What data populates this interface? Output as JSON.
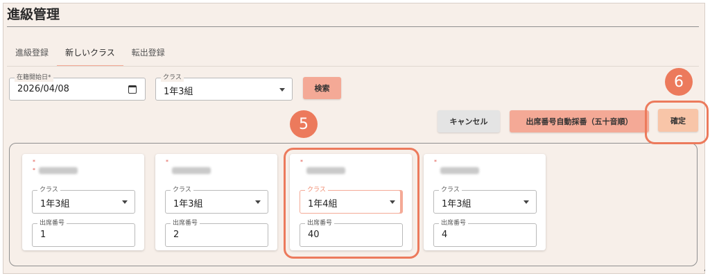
{
  "page": {
    "title": "進級管理"
  },
  "tabs": [
    {
      "label": "進級登録",
      "active": false
    },
    {
      "label": "新しいクラス",
      "active": true
    },
    {
      "label": "転出登録",
      "active": false
    }
  ],
  "filters": {
    "start_date": {
      "label": "在籍開始日*",
      "value": "2026/04/08",
      "icon": "calendar-icon"
    },
    "class": {
      "label": "クラス",
      "value": "1年3組",
      "icon": "chevron-down-icon"
    },
    "search_label": "検索"
  },
  "actions": {
    "cancel_label": "キャンセル",
    "auto_number_label": "出席番号自動採番（五十音順）",
    "confirm_label": "確定"
  },
  "students": [
    {
      "required_mark": "*",
      "class_label": "クラス",
      "class_value": "1年3組",
      "number_label": "出席番号",
      "number_value": "1"
    },
    {
      "required_mark": "*",
      "class_label": "クラス",
      "class_value": "1年3組",
      "number_label": "出席番号",
      "number_value": "2"
    },
    {
      "required_mark": "*",
      "class_label": "クラス",
      "class_value": "1年4組",
      "number_label": "出席番号",
      "number_value": "40"
    },
    {
      "required_mark": "*",
      "class_label": "クラス",
      "class_value": "1年3組",
      "number_label": "出席番号",
      "number_value": "4"
    }
  ],
  "annotations": {
    "step5": "5",
    "step6": "6",
    "accent_color": "#ec7a5c"
  },
  "edge_text": ","
}
